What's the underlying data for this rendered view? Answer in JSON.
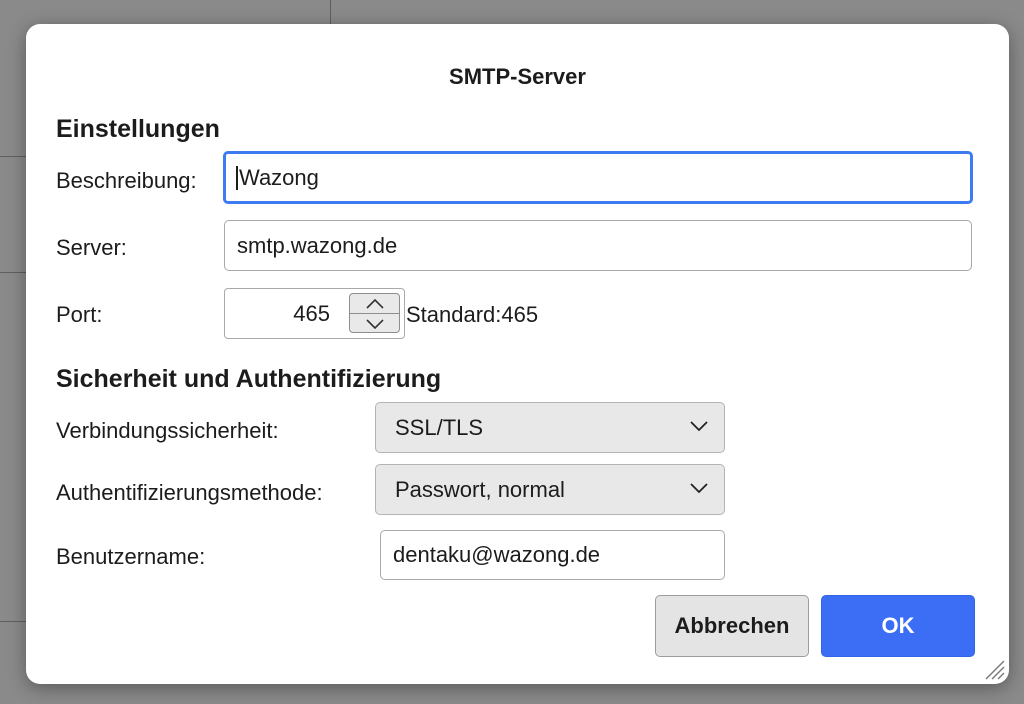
{
  "dialog": {
    "title": "SMTP-Server"
  },
  "settings": {
    "heading": "Einstellungen",
    "description_label": "Beschreibung:",
    "description_value": "Wazong",
    "server_label": "Server:",
    "server_value": "smtp.wazong.de",
    "port_label": "Port:",
    "port_value": "465",
    "port_default": "Standard:465"
  },
  "security": {
    "heading": "Sicherheit und Authentifizierung",
    "connection_label": "Verbindungssicherheit:",
    "connection_value": "SSL/TLS",
    "auth_label": "Authentifizierungsmethode:",
    "auth_value": "Passwort, normal",
    "username_label": "Benutzername:",
    "username_value": "dentaku@wazong.de"
  },
  "buttons": {
    "cancel_label": "Abbrechen",
    "ok_label": "OK"
  },
  "icons": {
    "stepper_up": "chevron-up-icon",
    "stepper_down": "chevron-down-icon",
    "select_arrow": "chevron-down-icon",
    "resize": "resize-grip-icon"
  },
  "colors": {
    "accent": "#3b6ef5",
    "focus_ring": "#3d7bf0",
    "backdrop": "#8a8a8a"
  }
}
